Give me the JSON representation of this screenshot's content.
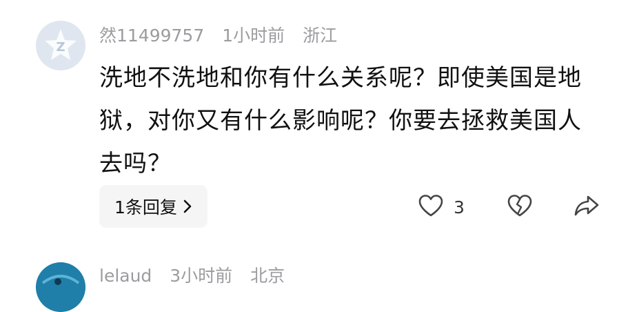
{
  "comments": [
    {
      "username": "然11499757",
      "time": "1小时前",
      "location": "浙江",
      "body": "洗地不洗地和你有什么关系呢？即使美国是地狱，对你又有什么影响呢？你要去拯救美国人去吗？",
      "reply_label": "1条回复",
      "like_count": "3",
      "avatar_icon": "default-avatar-icon",
      "avatar_color": "#dfe6f0"
    },
    {
      "username": "lelaud",
      "time": "3小时前",
      "location": "北京",
      "avatar_icon": "avatar-photo-icon",
      "avatar_color": "#1f7fa8"
    }
  ],
  "icons": {
    "like": "heart-icon",
    "dislike": "broken-heart-icon",
    "share": "share-arrow-icon",
    "reply_chevron": "chevron-right-icon"
  }
}
